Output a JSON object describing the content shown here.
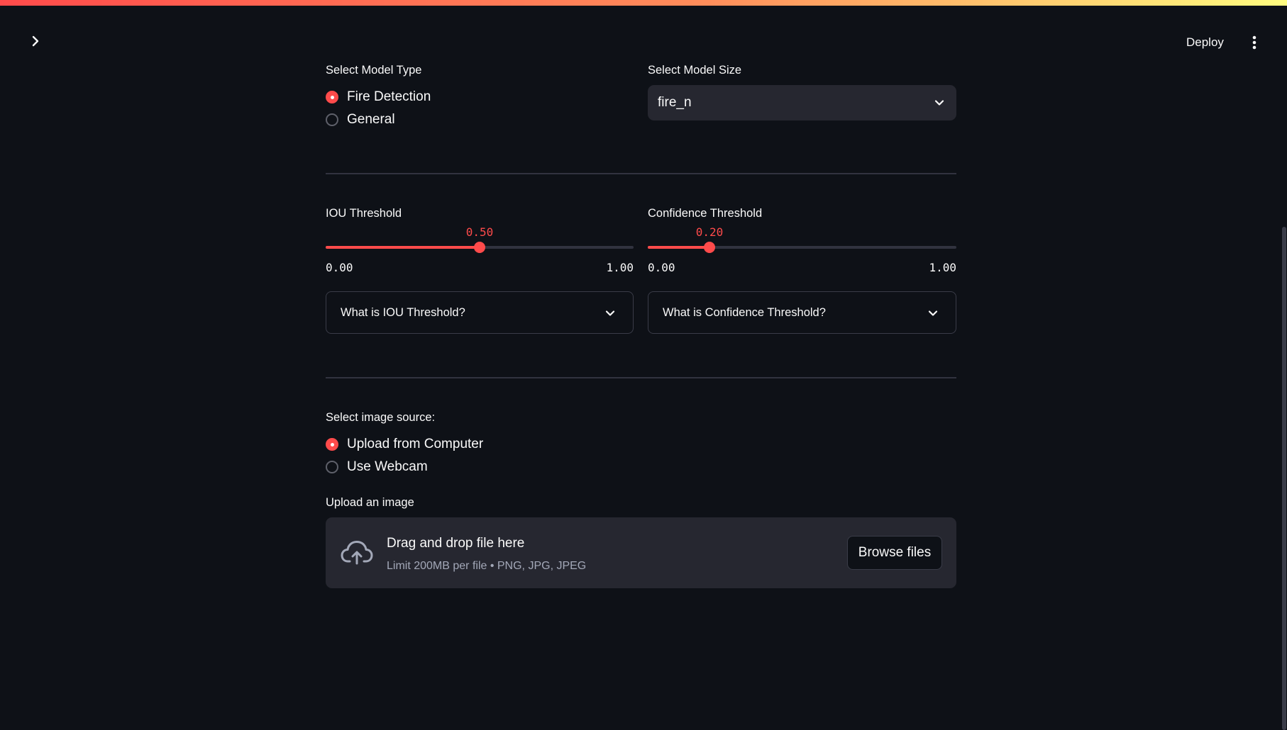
{
  "header": {
    "deploy_label": "Deploy"
  },
  "model": {
    "type_label": "Select Model Type",
    "type_options": [
      "Fire Detection",
      "General"
    ],
    "type_selected": "Fire Detection",
    "size_label": "Select Model Size",
    "size_value": "fire_n"
  },
  "iou": {
    "label": "IOU Threshold",
    "value": "0.50",
    "min": "0.00",
    "max": "1.00",
    "fraction": 0.5,
    "help": "What is IOU Threshold?"
  },
  "confidence": {
    "label": "Confidence Threshold",
    "value": "0.20",
    "min": "0.00",
    "max": "1.00",
    "fraction": 0.2,
    "help": "What is Confidence Threshold?"
  },
  "source": {
    "label": "Select image source:",
    "options": [
      "Upload from Computer",
      "Use Webcam"
    ],
    "selected": "Upload from Computer"
  },
  "upload": {
    "label": "Upload an image",
    "title": "Drag and drop file here",
    "subtitle": "Limit 200MB per file • PNG, JPG, JPEG",
    "browse_label": "Browse files"
  },
  "colors": {
    "accent": "#ff4b4b",
    "background": "#0e1117",
    "widget_bg": "#262730",
    "border": "#3a3c48"
  },
  "icons": {
    "sidebar_toggle": "chevron-right-icon",
    "menu": "more-vertical-icon",
    "select_chevron": "chevron-down-icon",
    "upload": "cloud-upload-icon"
  }
}
